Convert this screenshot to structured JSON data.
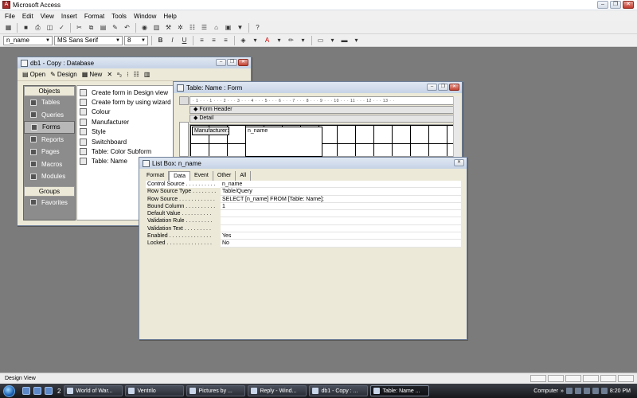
{
  "app": {
    "title": "Microsoft Access",
    "menu": [
      "File",
      "Edit",
      "View",
      "Insert",
      "Format",
      "Tools",
      "Window",
      "Help"
    ]
  },
  "format_toolbar": {
    "object_combo": "n_name",
    "font_combo": "MS Sans Serif",
    "size_combo": "8",
    "bold": "B",
    "italic": "I",
    "underline": "U"
  },
  "db_window": {
    "title": "db1 - Copy : Database",
    "toolbar": {
      "open": "Open",
      "design": "Design",
      "new": "New"
    },
    "objects_header": "Objects",
    "objects": [
      "Tables",
      "Queries",
      "Forms",
      "Reports",
      "Pages",
      "Macros",
      "Modules"
    ],
    "selected_object": "Forms",
    "groups_header": "Groups",
    "groups": [
      "Favorites"
    ],
    "forms_list": [
      "Create form in Design view",
      "Create form by using wizard",
      "Colour",
      "Manufacturer",
      "Style",
      "Switchboard",
      "Table: Color Subform",
      "Table: Name"
    ]
  },
  "form_window": {
    "title": "Table: Name : Form",
    "ruler": "· 1 · · · 1 · · · 2 · · · 3 · · · 4 · · · 5 · · · 6 · · · 7 · · · 8 · · · 9 · · · 10 · · · 11 · · · 12 · · · 13 · ·",
    "form_header_label": "Form Header",
    "detail_label": "Detail",
    "label_control": "Manufacturer:",
    "list_control": "n_name"
  },
  "property_sheet": {
    "title": "List Box: n_name",
    "tabs": [
      "Format",
      "Data",
      "Event",
      "Other",
      "All"
    ],
    "active_tab": "Data",
    "properties": [
      {
        "name": "Control Source . . . . . . . . . .",
        "value": "n_name"
      },
      {
        "name": "Row Source Type . . . . . . . .",
        "value": "Table/Query"
      },
      {
        "name": "Row Source . . . . . . . . . . . .",
        "value": "SELECT [n_name] FROM [Table: Name];"
      },
      {
        "name": "Bound Column . . . . . . . . . .",
        "value": "1"
      },
      {
        "name": "Default Value . . . . . . . . . .",
        "value": ""
      },
      {
        "name": "Validation Rule . . . . . . . . .",
        "value": ""
      },
      {
        "name": "Validation Text . . . . . . . . .",
        "value": ""
      },
      {
        "name": "Enabled . . . . . . . . . . . . . .",
        "value": "Yes"
      },
      {
        "name": "Locked . . . . . . . . . . . . . . .",
        "value": "No"
      }
    ]
  },
  "statusbar": {
    "text": "Design View"
  },
  "taskbar": {
    "badge": "2",
    "tasks": [
      {
        "label": "World of War...",
        "active": false
      },
      {
        "label": "Ventrilo",
        "active": false
      },
      {
        "label": "Pictures by ...",
        "active": false
      },
      {
        "label": "Reply - Wind...",
        "active": false
      },
      {
        "label": "db1 - Copy : ...",
        "active": false
      },
      {
        "label": "Table: Name ...",
        "active": true
      }
    ],
    "computer_label": "Computer",
    "clock": "8:20 PM"
  }
}
